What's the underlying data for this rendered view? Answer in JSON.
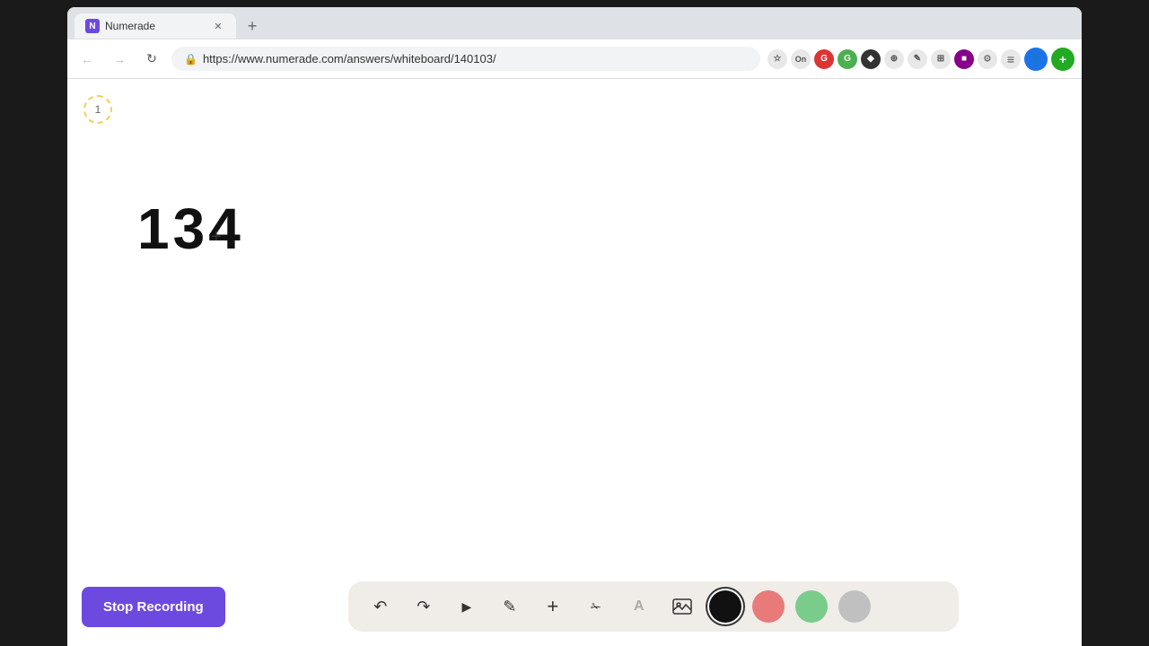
{
  "browser": {
    "tab": {
      "title": "Numerade",
      "favicon": "N",
      "favicon_bg": "#6c4ae0"
    },
    "url": "https://www.numerade.com/answers/whiteboard/140103/",
    "nav": {
      "back_disabled": true,
      "forward_disabled": true
    }
  },
  "whiteboard": {
    "page_number": "1",
    "content_text": "134",
    "cursor_type": "crosshair"
  },
  "toolbar": {
    "undo_label": "↺",
    "redo_label": "↻",
    "select_label": "▲",
    "pen_label": "✏",
    "add_label": "+",
    "eraser_label": "✂",
    "text_label": "A",
    "image_label": "🖼",
    "colors": [
      {
        "name": "black",
        "hex": "#111111",
        "active": true
      },
      {
        "name": "pink",
        "hex": "#e87a7a",
        "active": false
      },
      {
        "name": "green",
        "hex": "#7acc8a",
        "active": false
      },
      {
        "name": "gray",
        "hex": "#c0c0c0",
        "active": false
      }
    ],
    "stop_recording_label": "Stop Recording",
    "stop_recording_bg": "#6c4ae0"
  },
  "extensions": [
    {
      "id": "ext1",
      "label": "⚡",
      "bg": "#e8e8e8"
    },
    {
      "id": "ext2",
      "label": "G",
      "bg": "#e8e8e8",
      "color": "#dd3333"
    },
    {
      "id": "ext3",
      "label": "G",
      "bg": "#e8e8e8",
      "color": "#444"
    },
    {
      "id": "ext4",
      "label": "◆",
      "bg": "#e8e8e8"
    },
    {
      "id": "ext5",
      "label": "⊕",
      "bg": "#e8e8e8"
    },
    {
      "id": "ext6",
      "label": "✎",
      "bg": "#e8e8e8"
    },
    {
      "id": "ext7",
      "label": "⊞",
      "bg": "#e8e8e8"
    },
    {
      "id": "ext8",
      "label": "■",
      "bg": "#7700aa",
      "color": "#fff"
    },
    {
      "id": "ext9",
      "label": "O",
      "bg": "#e8e8e8"
    },
    {
      "id": "ext10",
      "label": "+",
      "bg": "#22aa22",
      "color": "#fff"
    }
  ]
}
